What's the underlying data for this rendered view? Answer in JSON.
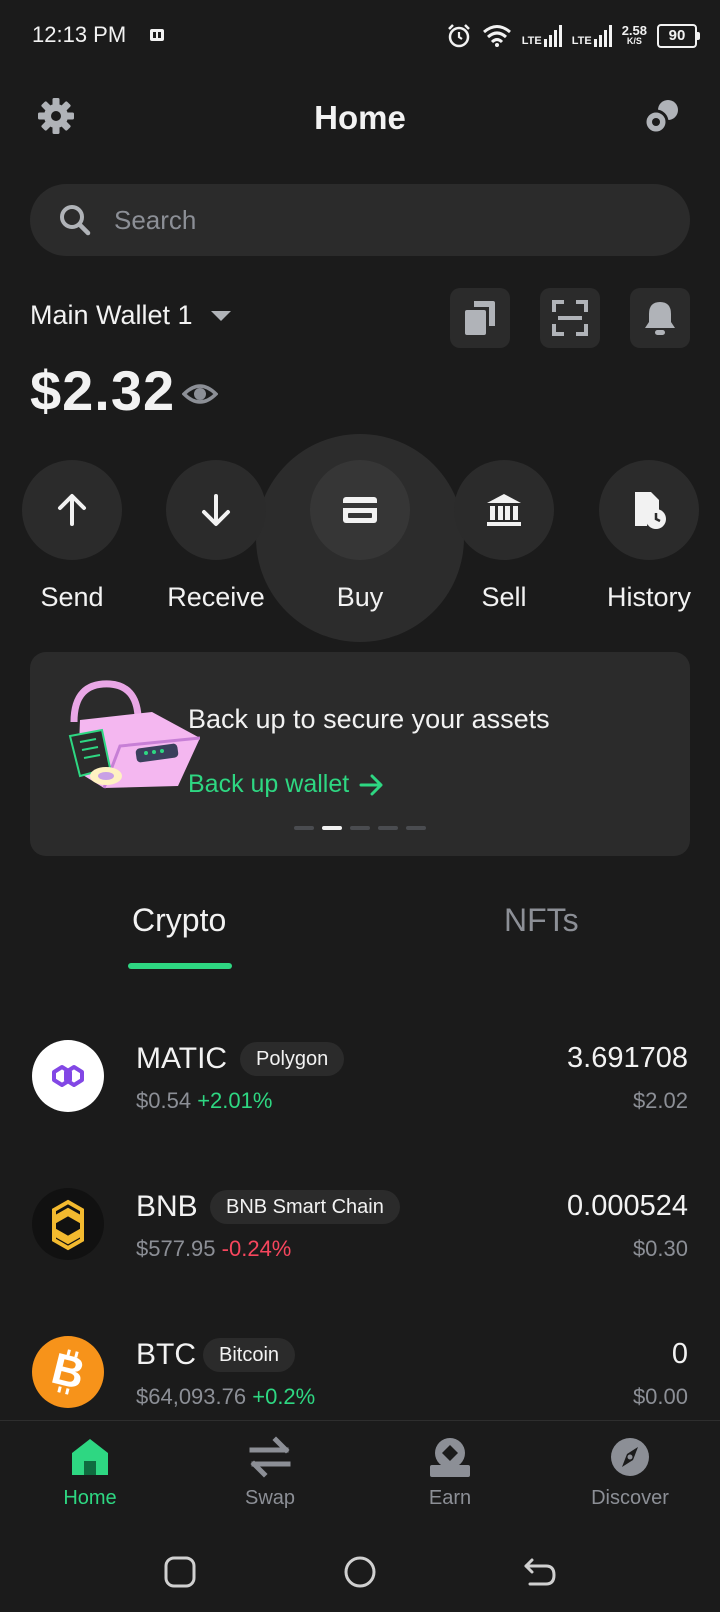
{
  "status_bar": {
    "time": "12:13 PM",
    "network1": "LTE",
    "network2": "LTE",
    "speed_value": "2.58",
    "speed_unit": "K/S",
    "battery": "90"
  },
  "header": {
    "title": "Home"
  },
  "search": {
    "placeholder": "Search"
  },
  "wallet": {
    "name": "Main Wallet 1",
    "balance": "$2.32"
  },
  "actions": [
    {
      "label": "Send"
    },
    {
      "label": "Receive"
    },
    {
      "label": "Buy"
    },
    {
      "label": "Sell"
    },
    {
      "label": "History"
    }
  ],
  "backup_card": {
    "title": "Back up to secure your assets",
    "link_label": "Back up wallet",
    "dots": 5,
    "active_dot": 1
  },
  "tabs": [
    {
      "label": "Crypto",
      "active": true
    },
    {
      "label": "NFTs",
      "active": false
    }
  ],
  "assets": [
    {
      "symbol": "MATIC",
      "chain": "Polygon",
      "price": "$0.54",
      "change": "+2.01%",
      "direction": "up",
      "amount": "3.691708",
      "value": "$2.02"
    },
    {
      "symbol": "BNB",
      "chain": "BNB Smart Chain",
      "price": "$577.95",
      "change": "-0.24%",
      "direction": "down",
      "amount": "0.000524",
      "value": "$0.30"
    },
    {
      "symbol": "BTC",
      "chain": "Bitcoin",
      "price": "$64,093.76",
      "change": "+0.2%",
      "direction": "up",
      "amount": "0",
      "value": "$0.00"
    }
  ],
  "bottom_nav": [
    {
      "label": "Home",
      "active": true
    },
    {
      "label": "Swap",
      "active": false
    },
    {
      "label": "Earn",
      "active": false
    },
    {
      "label": "Discover",
      "active": false
    }
  ],
  "colors": {
    "background": "#1b1b1b",
    "surface": "#2b2b2b",
    "accent": "#2ed782",
    "negative": "#f6465d",
    "muted": "#8c8f96",
    "matic": "#8247e5",
    "bnb": "#f3ba2f",
    "btc": "#f7931a"
  },
  "icons": {
    "settings": "gear-icon",
    "connect": "dapp-connect-icon",
    "search": "search-icon",
    "copy": "copy-icon",
    "scan": "scan-icon",
    "notifications": "bell-icon",
    "eye": "eye-icon"
  }
}
